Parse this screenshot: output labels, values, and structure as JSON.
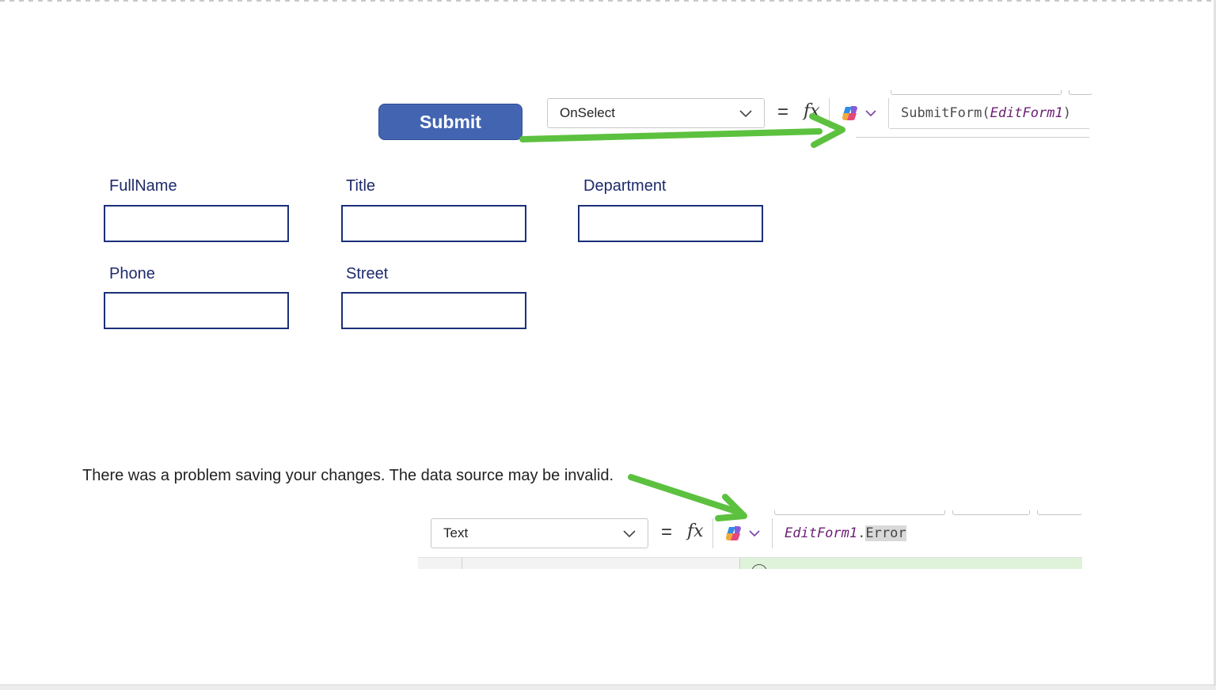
{
  "submit_button": {
    "label": "Submit"
  },
  "formula_bar_top": {
    "property": "OnSelect",
    "equals": "=",
    "fx": "fx",
    "formula_func": "SubmitForm(",
    "formula_arg": "EditForm1",
    "formula_close": ")"
  },
  "form_fields": [
    {
      "label": "FullName",
      "value": ""
    },
    {
      "label": "Title",
      "value": ""
    },
    {
      "label": "Department",
      "value": ""
    },
    {
      "label": "Phone",
      "value": ""
    },
    {
      "label": "Street",
      "value": ""
    }
  ],
  "error_message": "There was a problem saving your changes. The data source may be invalid.",
  "formula_bar_bottom": {
    "property": "Text",
    "equals": "=",
    "fx": "fx",
    "formula_object": "EditForm1",
    "formula_dot": ".",
    "formula_property": "Error"
  },
  "colors": {
    "submit_button": "#4264b1",
    "field_border": "#1b2f7a",
    "label_text": "#1f2a6b",
    "annotation_arrow": "#5cc13f",
    "formula_identifier": "#6b1f74"
  },
  "icons": {
    "copilot": "copilot-icon",
    "dropdown": "chevron-down-icon"
  }
}
